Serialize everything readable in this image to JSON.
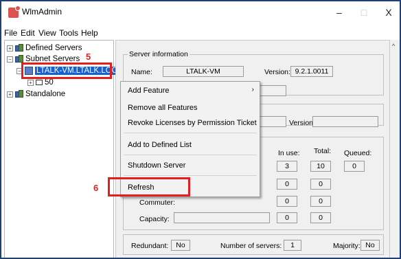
{
  "window": {
    "title": "WlmAdmin",
    "controls": {
      "minimize": "–",
      "maximize": "□",
      "close": "X"
    }
  },
  "menubar": {
    "items": [
      "File",
      "Edit",
      "View",
      "Tools",
      "Help"
    ]
  },
  "tree": {
    "defined_servers": "Defined Servers",
    "subnet_servers": "Subnet Servers",
    "selected_host": "LTALK-VM.LTALK.LOCAL",
    "child_node": "50",
    "standalone": "Standalone"
  },
  "markers": {
    "step5": "5",
    "step6": "6"
  },
  "server_information": {
    "group_title": "Server information",
    "name_label": "Name:",
    "name_value": "LTALK-VM",
    "version_label": "Version:",
    "version_value": "9.2.1.0011"
  },
  "second_section": {
    "version_label": "Version:"
  },
  "license_stats": {
    "in_use_label": "In use:",
    "total_label": "Total:",
    "queued_label": "Queued:",
    "in_use_value": "3",
    "total_value": "10",
    "queued_value": "0",
    "row2_in_use": "0",
    "row2_total": "0",
    "commuter_label": "Commuter:",
    "row3_in_use": "0",
    "row3_total": "0",
    "capacity_label": "Capacity:",
    "row4_in_use": "0",
    "row4_total": "0"
  },
  "redundancy": {
    "redundant_label": "Redundant:",
    "redundant_value": "No",
    "num_servers_label": "Number of servers:",
    "num_servers_value": "1",
    "majority_label": "Majority:",
    "majority_value": "No"
  },
  "context_menu": {
    "add_feature": "Add Feature",
    "submenu_arrow": "›",
    "remove_all_features": "Remove all Features",
    "revoke_licenses": "Revoke Licenses by Permission Ticket",
    "add_to_defined_list": "Add to Defined List",
    "shutdown_server": "Shutdown Server",
    "refresh": "Refresh"
  },
  "colors": {
    "marker_red": "#e02020",
    "selection_blue": "#1560d4"
  }
}
